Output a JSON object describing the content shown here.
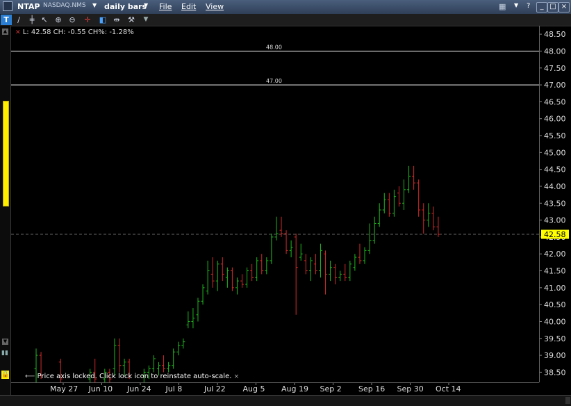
{
  "window": {
    "symbol": "NTAP",
    "exchange": "NASDAQ.NMS",
    "bar_type": "daily bars",
    "menus": [
      "File",
      "Edit",
      "View"
    ]
  },
  "readout": "L: 42.58 CH: -0.55 CH%: -1.28%",
  "lock_message": "Price axis locked. Click lock icon to reinstate auto-scale.",
  "colors": {
    "up": "#1fb81f",
    "down": "#d42a2a",
    "hline": "#ffffff",
    "price_tag": "#ffff00",
    "accent_yellow": "#ffee00"
  },
  "icons": [
    "trendline-icon",
    "bars-icon",
    "cursor-icon",
    "zoom-in-icon",
    "zoom-out-icon",
    "crosshair-icon",
    "split-icon",
    "range-icon",
    "wrench-icon",
    "dropdown-icon"
  ],
  "chart_data": {
    "type": "ohlc",
    "title": "",
    "ylim": [
      38.2,
      48.75
    ],
    "y_ticks": [
      "48.50",
      "48.00",
      "47.50",
      "47.00",
      "46.50",
      "46.00",
      "45.50",
      "45.00",
      "44.50",
      "44.00",
      "43.50",
      "43.00",
      "42.50",
      "42.00",
      "41.50",
      "41.00",
      "40.50",
      "40.00",
      "39.50",
      "39.00",
      "38.50"
    ],
    "x_ticks": [
      "May 27",
      "Jun 10",
      "Jun 24",
      "Jul 8",
      "Jul 22",
      "Aug 5",
      "Aug 19",
      "Sep 2",
      "Sep 16",
      "Sep 30",
      "Oct 14"
    ],
    "horizontal_lines": [
      {
        "label": "48.00",
        "value": 48.0
      },
      {
        "label": "47.00",
        "value": 47.0
      }
    ],
    "last_price": "42.58",
    "last_value": 42.58,
    "bars": [
      {
        "x": 0,
        "o": 38.6,
        "h": 39.2,
        "l": 38.2,
        "c": 39.0
      },
      {
        "x": 1,
        "o": 39.0,
        "h": 39.1,
        "l": 38.3,
        "c": 38.4
      },
      {
        "x": 5,
        "o": 38.8,
        "h": 38.9,
        "l": 38.2,
        "c": 38.3
      },
      {
        "x": 11,
        "o": 38.3,
        "h": 38.6,
        "l": 38.2,
        "c": 38.5
      },
      {
        "x": 12,
        "o": 38.5,
        "h": 38.9,
        "l": 38.2,
        "c": 38.3
      },
      {
        "x": 14,
        "o": 38.3,
        "h": 38.6,
        "l": 38.2,
        "c": 38.5
      },
      {
        "x": 15,
        "o": 38.5,
        "h": 38.6,
        "l": 38.2,
        "c": 38.3
      },
      {
        "x": 16,
        "o": 38.6,
        "h": 39.5,
        "l": 38.4,
        "c": 39.3
      },
      {
        "x": 17,
        "o": 39.3,
        "h": 39.5,
        "l": 38.5,
        "c": 38.7
      },
      {
        "x": 18,
        "o": 38.7,
        "h": 38.9,
        "l": 38.4,
        "c": 38.8
      },
      {
        "x": 19,
        "o": 38.8,
        "h": 38.9,
        "l": 38.3,
        "c": 38.4
      },
      {
        "x": 22,
        "o": 38.4,
        "h": 38.6,
        "l": 38.2,
        "c": 38.5
      },
      {
        "x": 23,
        "o": 38.5,
        "h": 38.7,
        "l": 38.3,
        "c": 38.6
      },
      {
        "x": 24,
        "o": 38.6,
        "h": 39.0,
        "l": 38.5,
        "c": 38.9
      },
      {
        "x": 25,
        "o": 38.6,
        "h": 38.8,
        "l": 38.4,
        "c": 38.7
      },
      {
        "x": 26,
        "o": 38.7,
        "h": 39.0,
        "l": 38.5,
        "c": 38.6
      },
      {
        "x": 27,
        "o": 38.6,
        "h": 38.8,
        "l": 38.5,
        "c": 38.7
      },
      {
        "x": 28,
        "o": 38.7,
        "h": 39.2,
        "l": 38.6,
        "c": 39.1
      },
      {
        "x": 29,
        "o": 39.1,
        "h": 39.4,
        "l": 39.0,
        "c": 39.3
      },
      {
        "x": 30,
        "o": 39.3,
        "h": 39.5,
        "l": 39.2,
        "c": 39.4
      },
      {
        "x": 31,
        "o": 39.9,
        "h": 40.3,
        "l": 39.8,
        "c": 40.0
      },
      {
        "x": 32,
        "o": 40.0,
        "h": 40.4,
        "l": 39.8,
        "c": 40.1
      },
      {
        "x": 33,
        "o": 40.2,
        "h": 40.7,
        "l": 40.0,
        "c": 40.6
      },
      {
        "x": 34,
        "o": 40.6,
        "h": 41.1,
        "l": 40.5,
        "c": 41.0
      },
      {
        "x": 35,
        "o": 40.9,
        "h": 41.8,
        "l": 40.8,
        "c": 41.5
      },
      {
        "x": 36,
        "o": 41.4,
        "h": 41.9,
        "l": 41.0,
        "c": 41.2
      },
      {
        "x": 37,
        "o": 41.2,
        "h": 41.8,
        "l": 40.9,
        "c": 41.7
      },
      {
        "x": 38,
        "o": 41.7,
        "h": 41.9,
        "l": 41.2,
        "c": 41.4
      },
      {
        "x": 39,
        "o": 41.3,
        "h": 41.6,
        "l": 41.0,
        "c": 41.5
      },
      {
        "x": 40,
        "o": 41.5,
        "h": 41.6,
        "l": 40.9,
        "c": 41.0
      },
      {
        "x": 41,
        "o": 41.0,
        "h": 41.3,
        "l": 40.8,
        "c": 41.2
      },
      {
        "x": 42,
        "o": 41.2,
        "h": 41.4,
        "l": 41.0,
        "c": 41.1
      },
      {
        "x": 43,
        "o": 41.1,
        "h": 41.6,
        "l": 41.0,
        "c": 41.5
      },
      {
        "x": 44,
        "o": 41.5,
        "h": 41.7,
        "l": 41.2,
        "c": 41.3
      },
      {
        "x": 45,
        "o": 41.3,
        "h": 41.9,
        "l": 41.2,
        "c": 41.8
      },
      {
        "x": 46,
        "o": 41.8,
        "h": 42.0,
        "l": 41.4,
        "c": 41.5
      },
      {
        "x": 47,
        "o": 41.5,
        "h": 41.9,
        "l": 41.4,
        "c": 41.8
      },
      {
        "x": 48,
        "o": 41.8,
        "h": 42.6,
        "l": 41.7,
        "c": 42.5
      },
      {
        "x": 49,
        "o": 42.5,
        "h": 43.1,
        "l": 42.4,
        "c": 42.6
      },
      {
        "x": 50,
        "o": 42.7,
        "h": 43.1,
        "l": 42.5,
        "c": 42.6
      },
      {
        "x": 51,
        "o": 42.6,
        "h": 42.7,
        "l": 42.0,
        "c": 42.1
      },
      {
        "x": 52,
        "o": 42.1,
        "h": 42.4,
        "l": 41.9,
        "c": 42.2
      },
      {
        "x": 53,
        "o": 42.5,
        "h": 42.6,
        "l": 40.2,
        "c": 41.6
      },
      {
        "x": 54,
        "o": 41.9,
        "h": 42.3,
        "l": 41.8,
        "c": 42.0
      },
      {
        "x": 55,
        "o": 41.8,
        "h": 42.0,
        "l": 41.4,
        "c": 41.5
      },
      {
        "x": 56,
        "o": 41.5,
        "h": 41.9,
        "l": 41.2,
        "c": 41.8
      },
      {
        "x": 57,
        "o": 41.7,
        "h": 42.0,
        "l": 41.4,
        "c": 41.5
      },
      {
        "x": 58,
        "o": 41.5,
        "h": 42.3,
        "l": 41.3,
        "c": 42.1
      },
      {
        "x": 59,
        "o": 42.0,
        "h": 42.1,
        "l": 40.8,
        "c": 41.4
      },
      {
        "x": 60,
        "o": 41.4,
        "h": 41.8,
        "l": 41.2,
        "c": 41.6
      },
      {
        "x": 61,
        "o": 41.6,
        "h": 41.7,
        "l": 41.1,
        "c": 41.3
      },
      {
        "x": 62,
        "o": 41.3,
        "h": 41.5,
        "l": 41.2,
        "c": 41.4
      },
      {
        "x": 63,
        "o": 41.4,
        "h": 41.7,
        "l": 41.2,
        "c": 41.3
      },
      {
        "x": 64,
        "o": 41.3,
        "h": 41.8,
        "l": 41.2,
        "c": 41.7
      },
      {
        "x": 65,
        "o": 41.6,
        "h": 42.0,
        "l": 41.5,
        "c": 41.9
      },
      {
        "x": 66,
        "o": 41.9,
        "h": 42.3,
        "l": 41.7,
        "c": 41.8
      },
      {
        "x": 67,
        "o": 41.8,
        "h": 42.2,
        "l": 41.7,
        "c": 42.1
      },
      {
        "x": 68,
        "o": 42.1,
        "h": 42.9,
        "l": 42.0,
        "c": 42.4
      },
      {
        "x": 69,
        "o": 42.4,
        "h": 43.1,
        "l": 42.3,
        "c": 42.9
      },
      {
        "x": 70,
        "o": 42.9,
        "h": 43.5,
        "l": 42.8,
        "c": 43.3
      },
      {
        "x": 71,
        "o": 43.3,
        "h": 43.8,
        "l": 43.2,
        "c": 43.6
      },
      {
        "x": 72,
        "o": 43.6,
        "h": 43.8,
        "l": 43.1,
        "c": 43.2
      },
      {
        "x": 73,
        "o": 43.2,
        "h": 43.9,
        "l": 43.1,
        "c": 43.7
      },
      {
        "x": 74,
        "o": 43.8,
        "h": 44.0,
        "l": 43.4,
        "c": 43.5
      },
      {
        "x": 75,
        "o": 43.5,
        "h": 44.2,
        "l": 43.3,
        "c": 43.9
      },
      {
        "x": 76,
        "o": 43.9,
        "h": 44.6,
        "l": 43.8,
        "c": 44.3
      },
      {
        "x": 77,
        "o": 44.3,
        "h": 44.6,
        "l": 43.9,
        "c": 44.1
      },
      {
        "x": 78,
        "o": 44.1,
        "h": 44.2,
        "l": 43.1,
        "c": 43.3
      },
      {
        "x": 79,
        "o": 43.3,
        "h": 43.5,
        "l": 42.6,
        "c": 43.0
      },
      {
        "x": 80,
        "o": 43.0,
        "h": 43.5,
        "l": 42.8,
        "c": 43.2
      },
      {
        "x": 81,
        "o": 43.2,
        "h": 43.4,
        "l": 42.7,
        "c": 42.8
      },
      {
        "x": 82,
        "o": 42.8,
        "h": 43.1,
        "l": 42.5,
        "c": 42.58
      }
    ]
  }
}
